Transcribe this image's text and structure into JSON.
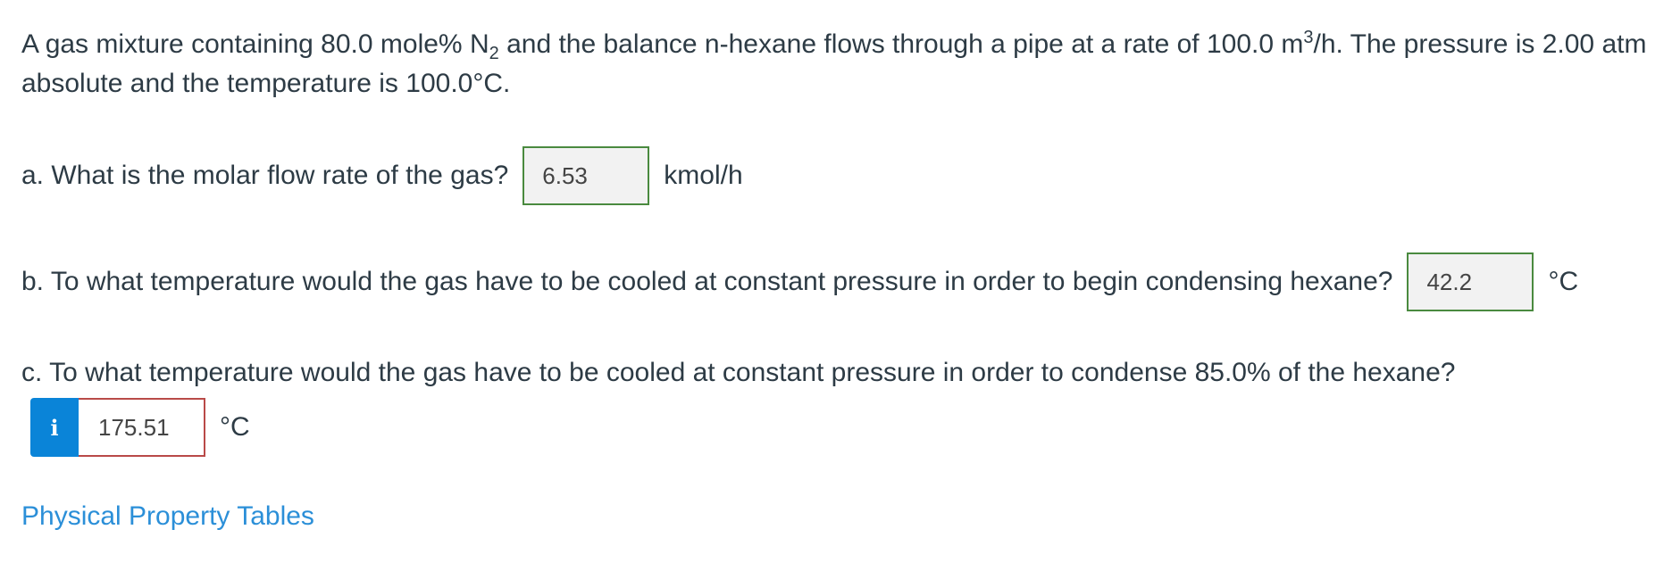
{
  "problem": {
    "text_part1": "A gas mixture containing 80.0 mole% N",
    "sub": "2",
    "text_part2": " and the balance n-hexane flows through a pipe at a rate of 100.0 m",
    "sup": "3",
    "text_part3": "/h. The pressure is 2.00 atm absolute and the temperature is 100.0°C."
  },
  "question_a": {
    "label": "a. What is the molar flow rate of the gas?",
    "answer": "6.53",
    "unit": "kmol/h",
    "status": "correct"
  },
  "question_b": {
    "label": "b. To what temperature would the gas have to be cooled at constant pressure in order to begin condensing hexane?",
    "answer": "42.2",
    "unit": "°C",
    "status": "correct"
  },
  "question_c": {
    "label": "c. To what temperature would the gas have to be cooled at constant pressure in order to condense 85.0% of the hexane?",
    "info_icon": "i",
    "answer": "175.51",
    "unit": "°C",
    "status": "incorrect"
  },
  "links": {
    "property_tables": "Physical Property Tables"
  },
  "colors": {
    "correct_border": "#4a8a3f",
    "incorrect_border": "#b94a48",
    "info_button": "#0a84d8",
    "link": "#2b8fd8"
  }
}
